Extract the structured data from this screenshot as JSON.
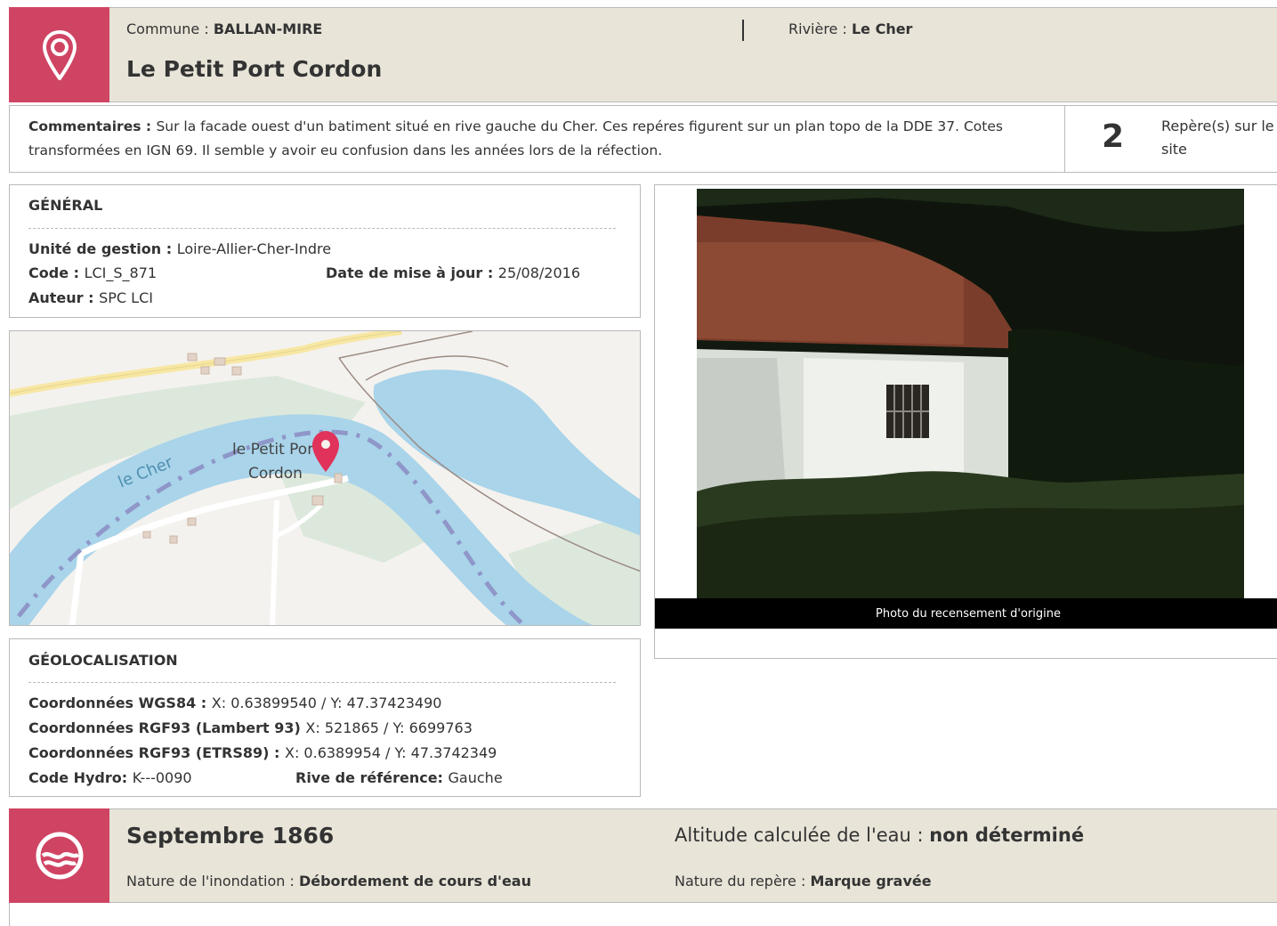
{
  "header": {
    "commune_label": "Commune : ",
    "commune": "BALLAN-MIRE",
    "riviere_label": "Rivière : ",
    "riviere": "Le Cher",
    "title": "Le Petit Port Cordon"
  },
  "comments": {
    "label": "Commentaires : ",
    "text": "Sur la facade ouest d'un batiment situé en rive gauche du Cher. Ces repéres figurent sur un plan topo de la DDE 37. Cotes transformées en IGN 69. Il semble y avoir eu confusion dans les années lors de la réfection.",
    "count": "2",
    "count_label": "Repère(s) sur le site"
  },
  "general": {
    "title": "GÉNÉRAL",
    "unite_label": "Unité de gestion : ",
    "unite": "Loire-Allier-Cher-Indre",
    "code_label": "Code : ",
    "code": "LCI_S_871",
    "date_label": "Date de mise à jour : ",
    "date": "25/08/2016",
    "auteur_label": "Auteur : ",
    "auteur": "SPC LCI"
  },
  "map": {
    "river_label": "le Cher",
    "place_line1": "le Petit Port",
    "place_line2": "Cordon",
    "marker_color": "#e0325a",
    "water_color": "#a9d4ea",
    "path_color": "#8f96c8"
  },
  "photo": {
    "caption": "Photo du recensement d'origine"
  },
  "geoloc": {
    "title": "GÉOLOCALISATION",
    "wgs_label": "Coordonnées WGS84 : ",
    "wgs": "X: 0.63899540 / Y: 47.37423490",
    "l93_label": "Coordonnées RGF93 (Lambert 93) ",
    "l93": "X: 521865 / Y: 6699763",
    "etrs_label": "Coordonnées RGF93 (ETRS89) : ",
    "etrs": "X: 0.6389954 / Y: 47.3742349",
    "hydro_label": "Code Hydro: ",
    "hydro": "K---0090",
    "rive_label": "Rive de référence: ",
    "rive": "Gauche"
  },
  "flood": {
    "date": "Septembre 1866",
    "alt_label": "Altitude calculée de l'eau : ",
    "alt": "non déterminé",
    "nature_label": "Nature de l'inondation : ",
    "nature": "Débordement de cours d'eau",
    "repere_label": "Nature du repère : ",
    "repere": "Marque gravée"
  },
  "colors": {
    "accent": "#d04463",
    "header_bg": "#e8e4d8",
    "border": "#b9b9b9"
  },
  "icons": [
    "map-pin-icon",
    "water-wave-icon"
  ]
}
